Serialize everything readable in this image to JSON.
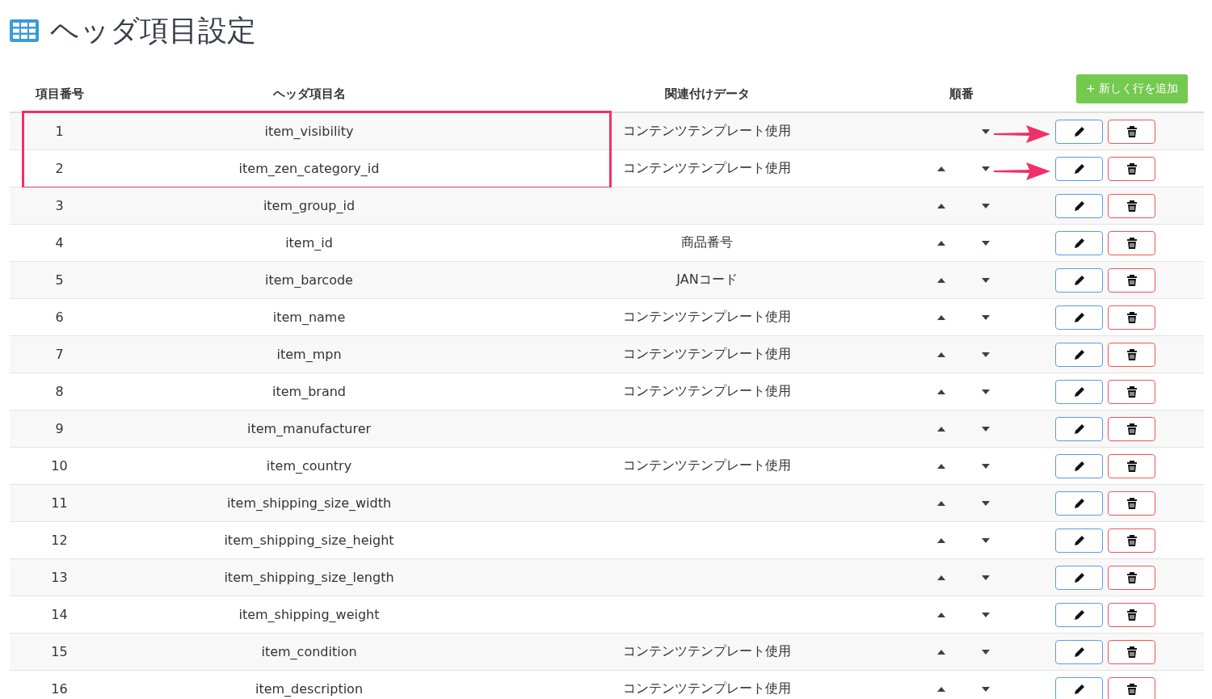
{
  "title": "ヘッダ項目設定",
  "columns": [
    "項目番号",
    "ヘッダ項目名",
    "関連付けデータ",
    "順番"
  ],
  "add_button": "+ 新しく行を追加",
  "rows": [
    {
      "number": "1",
      "name": "item_visibility",
      "related": "コンテンツテンプレート使用",
      "can_move_up": false,
      "highlighted": true,
      "arrow": true
    },
    {
      "number": "2",
      "name": "item_zen_category_id",
      "related": "コンテンツテンプレート使用",
      "can_move_up": true,
      "highlighted": true,
      "arrow": true
    },
    {
      "number": "3",
      "name": "item_group_id",
      "can_move_up": true,
      "highlighted": false,
      "arrow": false
    },
    {
      "number": "4",
      "name": "item_id",
      "related": "商品番号",
      "can_move_up": true,
      "highlighted": false,
      "arrow": false
    },
    {
      "number": "5",
      "name": "item_barcode",
      "related": "JANコード",
      "can_move_up": true,
      "highlighted": false,
      "arrow": false
    },
    {
      "number": "6",
      "name": "item_name",
      "related": "コンテンツテンプレート使用",
      "can_move_up": true,
      "highlighted": false,
      "arrow": false
    },
    {
      "number": "7",
      "name": "item_mpn",
      "related": "コンテンツテンプレート使用",
      "can_move_up": true,
      "highlighted": false,
      "arrow": false
    },
    {
      "number": "8",
      "name": "item_brand",
      "related": "コンテンツテンプレート使用",
      "can_move_up": true,
      "highlighted": false,
      "arrow": false
    },
    {
      "number": "9",
      "name": "item_manufacturer",
      "can_move_up": true,
      "highlighted": false,
      "arrow": false
    },
    {
      "number": "10",
      "name": "item_country",
      "related": "コンテンツテンプレート使用",
      "can_move_up": true,
      "highlighted": false,
      "arrow": false
    },
    {
      "number": "11",
      "name": "item_shipping_size_width",
      "can_move_up": true,
      "highlighted": false,
      "arrow": false
    },
    {
      "number": "12",
      "name": "item_shipping_size_height",
      "can_move_up": true,
      "highlighted": false,
      "arrow": false
    },
    {
      "number": "13",
      "name": "item_shipping_size_length",
      "can_move_up": true,
      "highlighted": false,
      "arrow": false
    },
    {
      "number": "14",
      "name": "item_shipping_weight",
      "can_move_up": true,
      "highlighted": false,
      "arrow": false
    },
    {
      "number": "15",
      "name": "item_condition",
      "related": "コンテンツテンプレート使用",
      "can_move_up": true,
      "highlighted": false,
      "arrow": false
    },
    {
      "number": "16",
      "name": "item_description",
      "related": "コンテンツテンプレート使用",
      "can_move_up": true,
      "highlighted": false,
      "arrow": false
    }
  ]
}
